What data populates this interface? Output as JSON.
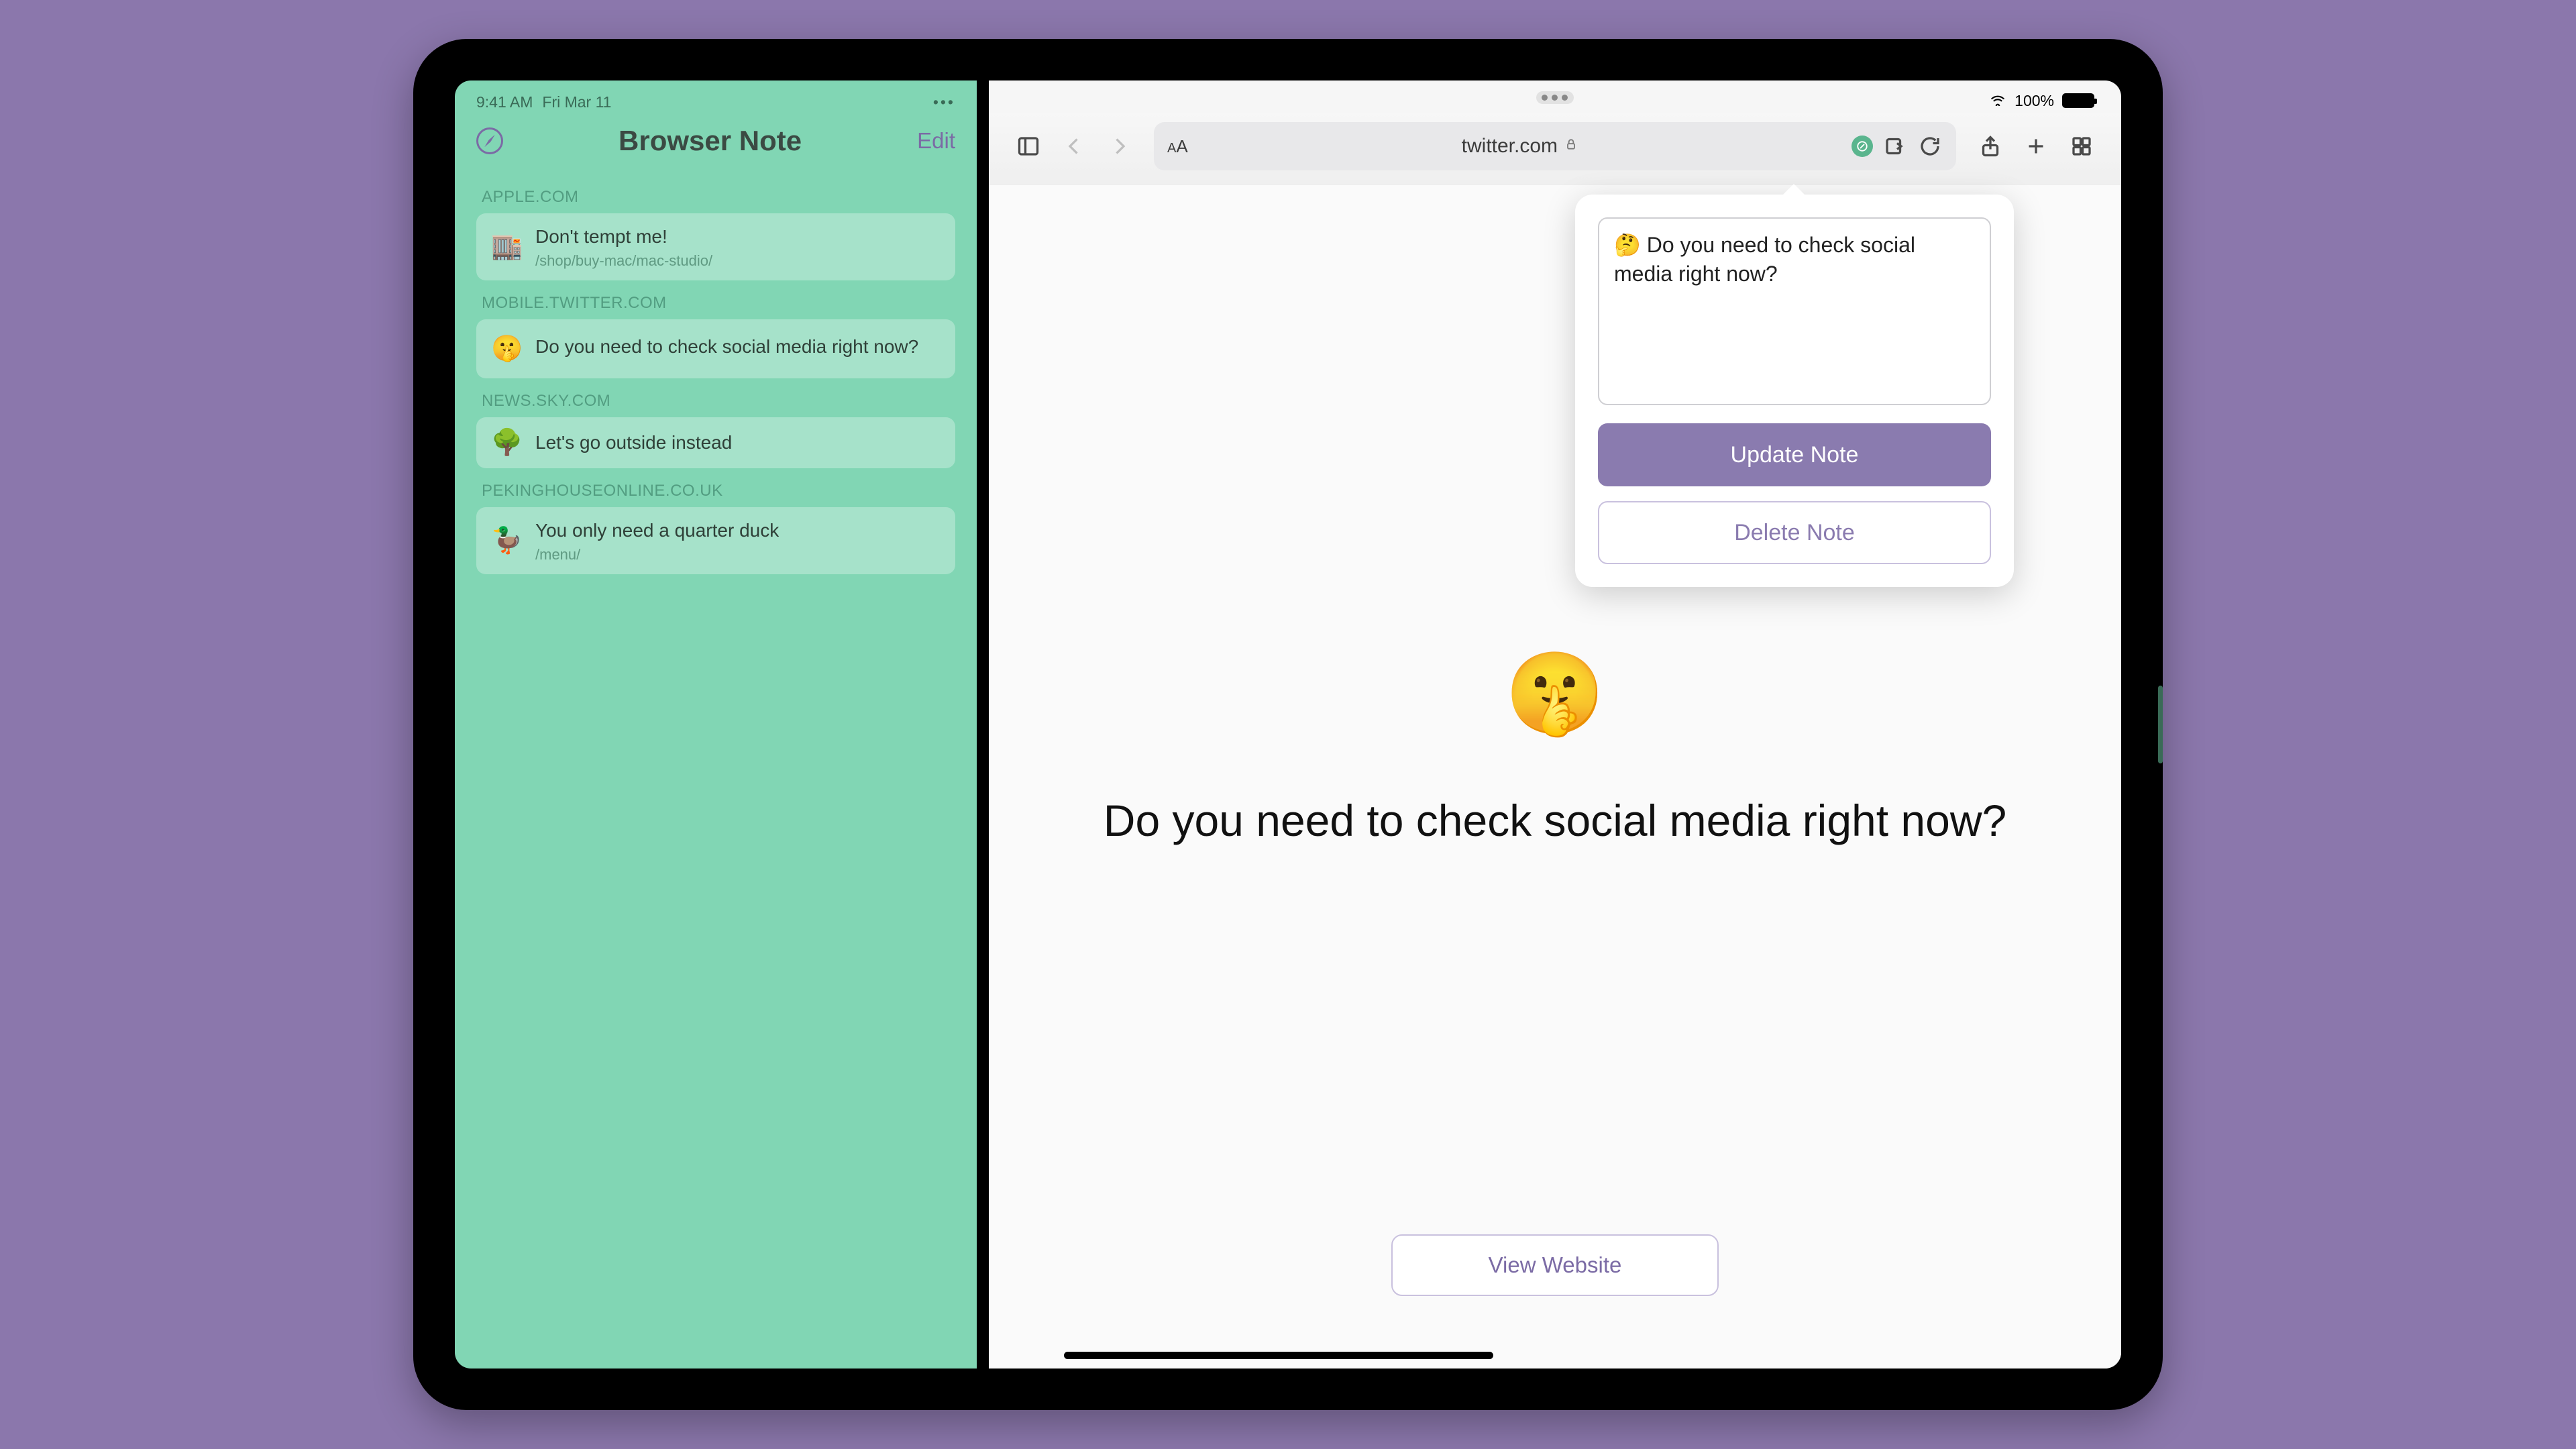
{
  "left_status": {
    "time": "9:41 AM",
    "date": "Fri Mar 11"
  },
  "left_app": {
    "title": "Browser Note",
    "edit_label": "Edit",
    "sections": [
      {
        "label": "APPLE.COM",
        "note": {
          "emoji": "🏬",
          "title": "Don't tempt me!",
          "sub": "/shop/buy-mac/mac-studio/"
        }
      },
      {
        "label": "MOBILE.TWITTER.COM",
        "note": {
          "emoji": "🤫",
          "title": "Do you need to check social media right now?",
          "sub": ""
        }
      },
      {
        "label": "NEWS.SKY.COM",
        "note": {
          "emoji": "🌳",
          "title": "Let's go outside instead",
          "sub": ""
        }
      },
      {
        "label": "PEKINGHOUSEONLINE.CO.UK",
        "note": {
          "emoji": "🦆",
          "title": "You only need a quarter duck",
          "sub": "/menu/"
        }
      }
    ]
  },
  "right_status": {
    "battery": "100%"
  },
  "safari": {
    "url": "twitter.com"
  },
  "popover": {
    "note_text": "🤔 Do you need to check social media right now?",
    "update_label": "Update Note",
    "delete_label": "Delete Note"
  },
  "page": {
    "emoji": "🤫",
    "headline": "Do you need to check social media right now?",
    "view_label": "View Website"
  }
}
